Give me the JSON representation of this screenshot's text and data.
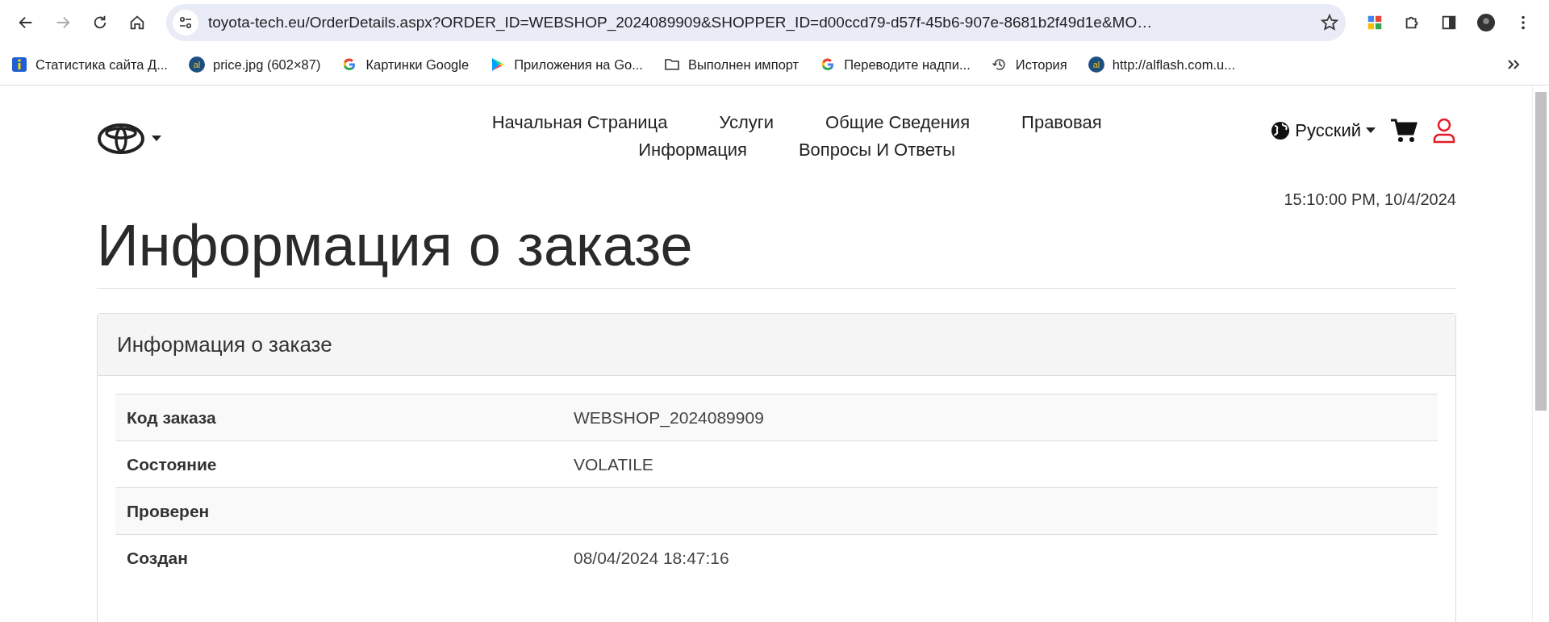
{
  "browser": {
    "address": "toyota-tech.eu/OrderDetails.aspx?ORDER_ID=WEBSHOP_2024089909&SHOPPER_ID=d00ccd79-d57f-45b6-907e-8681b2f49d1e&MO…",
    "bookmarks": [
      {
        "kind": "info",
        "label": "Статистика сайта Д..."
      },
      {
        "kind": "al",
        "label": "price.jpg (602×87)"
      },
      {
        "kind": "google",
        "label": "Картинки Google"
      },
      {
        "kind": "play",
        "label": "Приложения на Go..."
      },
      {
        "kind": "folder",
        "label": "Выполнен импорт"
      },
      {
        "kind": "google",
        "label": "Переводите надпи..."
      },
      {
        "kind": "history",
        "label": "История"
      },
      {
        "kind": "al",
        "label": "http://alflash.com.u..."
      }
    ]
  },
  "site_header": {
    "nav": [
      "Начальная Страница",
      "Услуги",
      "Общие Сведения",
      "Правовая",
      "Информация",
      "Вопросы И Ответы"
    ],
    "language": "Русский",
    "datetime": "15:10:00 PM, 10/4/2024"
  },
  "page_title": "Информация о заказе",
  "panel": {
    "title": "Информация о заказе",
    "rows": [
      {
        "label": "Код заказа",
        "value": "WEBSHOP_2024089909"
      },
      {
        "label": "Состояние",
        "value": "VOLATILE"
      },
      {
        "label": "Проверен"
      },
      {
        "label": "Создан",
        "value": "08/04/2024 18:47:16"
      }
    ]
  }
}
